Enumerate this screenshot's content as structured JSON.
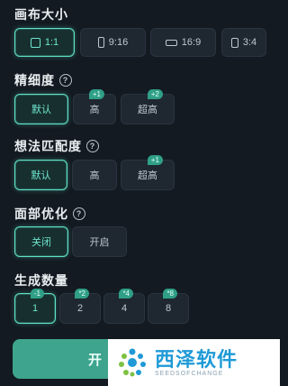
{
  "canvas_size": {
    "title": "画布大小",
    "options": [
      {
        "label": "1:1",
        "icon": "square-ratio-icon",
        "active": true
      },
      {
        "label": "9:16",
        "icon": "portrait-ratio-icon",
        "active": false
      },
      {
        "label": "16:9",
        "icon": "landscape-ratio-icon",
        "active": false
      },
      {
        "label": "3:4",
        "icon": "portrait-ratio-icon",
        "active": false
      }
    ]
  },
  "detail": {
    "title": "精细度",
    "help": "?",
    "options": [
      {
        "label": "默认",
        "badge": "",
        "active": true
      },
      {
        "label": "高",
        "badge": "+1",
        "active": false
      },
      {
        "label": "超高",
        "badge": "+2",
        "active": false
      }
    ]
  },
  "idea_match": {
    "title": "想法匹配度",
    "help": "?",
    "options": [
      {
        "label": "默认",
        "badge": "",
        "active": true
      },
      {
        "label": "高",
        "badge": "",
        "active": false
      },
      {
        "label": "超高",
        "badge": "+1",
        "active": false
      }
    ]
  },
  "face_opt": {
    "title": "面部优化",
    "help": "?",
    "options": [
      {
        "label": "关闭",
        "active": true
      },
      {
        "label": "开启",
        "active": false
      }
    ]
  },
  "gen_count": {
    "title": "生成数量",
    "options": [
      {
        "label": "1",
        "badge": "-1",
        "active": true
      },
      {
        "label": "2",
        "badge": "*2",
        "active": false
      },
      {
        "label": "4",
        "badge": "*4",
        "active": false
      },
      {
        "label": "8",
        "badge": "*8",
        "active": false
      }
    ]
  },
  "generate_button": {
    "label": "开"
  },
  "watermark": {
    "main": "西泽软件",
    "sub": "SEEDSOFCHANGE"
  },
  "colors": {
    "accent": "#5fe1c7",
    "background": "#131a21",
    "button": "#1f2731"
  }
}
